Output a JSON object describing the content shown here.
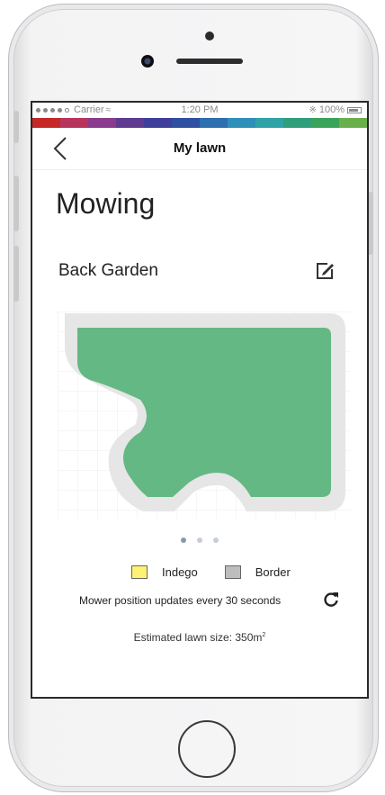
{
  "statusbar": {
    "carrier": "Carrier",
    "time": "1:20 PM",
    "battery": "100%"
  },
  "navbar": {
    "title": "My lawn"
  },
  "page": {
    "title": "Mowing",
    "lawn_name": "Back Garden"
  },
  "legend": {
    "items": [
      {
        "label": "Indego",
        "color": "#fff176"
      },
      {
        "label": "Border",
        "color": "#bdbdbd"
      }
    ]
  },
  "info": {
    "update_text": "Mower position updates every 30 seconds",
    "size_prefix": "Estimated lawn size: 350m",
    "size_sup": "2"
  },
  "carousel": {
    "count": 3,
    "active": 1
  },
  "colors": {
    "lawn": "#64b883",
    "border": "#e6e6e6",
    "strip": [
      "#c62828",
      "#b8345c",
      "#8a3b8e",
      "#5e3a91",
      "#3e3f9a",
      "#2f4fa0",
      "#2e6fb0",
      "#2e8fb8",
      "#2fa3a8",
      "#2f9e7a",
      "#3aa35a",
      "#6ab04a"
    ]
  }
}
